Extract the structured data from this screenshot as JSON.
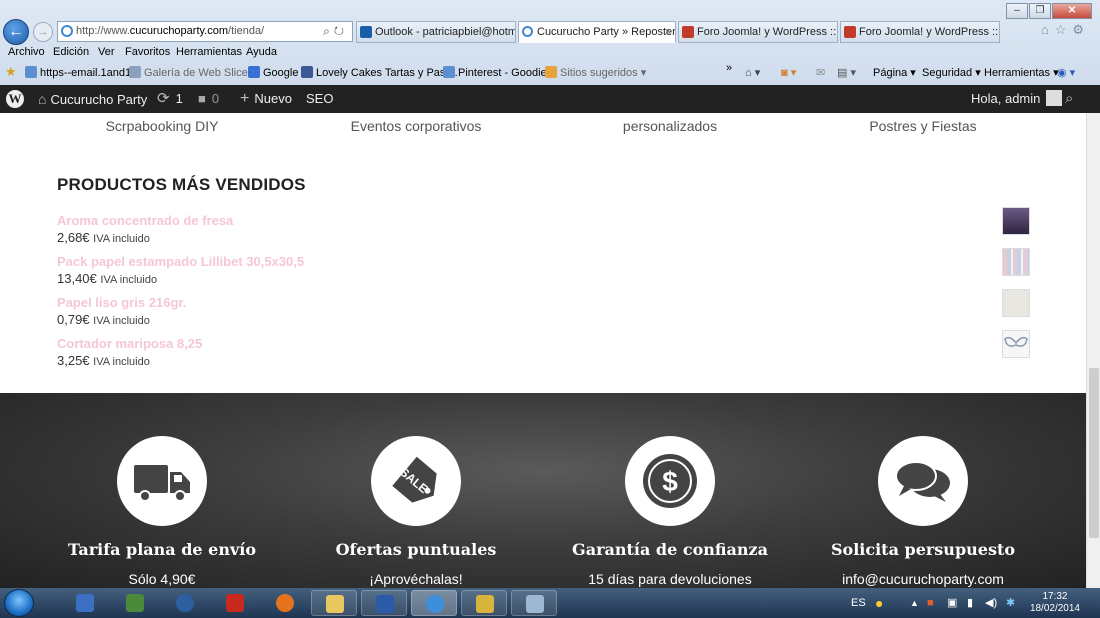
{
  "browser": {
    "address": {
      "prefix": "http://www.",
      "domain": "cucuruchoparty.com",
      "path": "/tienda/"
    },
    "tabs": [
      {
        "label": "Outlook - patriciapbiel@hotm...",
        "icon": "outlook-icon",
        "color": "#1a5ea8"
      },
      {
        "label": "Cucurucho Party » Reposter...",
        "icon": "ie-page-icon",
        "color": "#3f8ad0",
        "close": "×"
      },
      {
        "label": "Foro Joomla! y WordPress :: Te...",
        "icon": "forum-icon",
        "color": "#c23a2a"
      },
      {
        "label": "Foro Joomla! y WordPress :: Te...",
        "icon": "forum-icon",
        "color": "#c23a2a"
      }
    ],
    "menu": [
      "Archivo",
      "Edición",
      "Ver",
      "Favoritos",
      "Herramientas",
      "Ayuda"
    ],
    "favorites": [
      {
        "label": "https--email.1and1",
        "icon": "page-icon",
        "color": "#5b8fd0"
      },
      {
        "label": "Galería de Web Slice ▾",
        "icon": "webslice-icon",
        "color": "#8aa0bd",
        "muted": true
      },
      {
        "label": "Google",
        "icon": "google-icon",
        "color": "#3b6fd8"
      },
      {
        "label": "Lovely Cakes Tartas y Past...",
        "icon": "facebook-icon",
        "color": "#3b5998"
      },
      {
        "label": "Pinterest - Goodies",
        "icon": "page-icon",
        "color": "#5b8fd0"
      },
      {
        "label": "Sitios sugeridos ▾",
        "icon": "rss-icon",
        "color": "#e8a23a",
        "muted": true
      }
    ],
    "commands": [
      "Página ▾",
      "Seguridad ▾",
      "Herramientas ▾"
    ]
  },
  "wp_admin_bar": {
    "site_name": "Cucurucho Party",
    "updates_count": "1",
    "comments_count": "0",
    "new_label": "Nuevo",
    "seo_label": "SEO",
    "greeting": "Hola, admin"
  },
  "categories": [
    "Scrpabooking DIY",
    "Eventos corporativos",
    "personalizados",
    "Postres y Fiestas"
  ],
  "section_title": "PRODUCTOS MÁS VENDIDOS",
  "products": [
    {
      "name": "Aroma concentrado de fresa",
      "price": "2,68€",
      "tax": "IVA incluido",
      "thumb_color": "#4a3b5e"
    },
    {
      "name": "Pack papel estampado Lillibet 30,5x30,5",
      "price": "13,40€",
      "tax": "IVA incluido",
      "thumb_color": "#c9d3e0"
    },
    {
      "name": "Papel liso gris 216gr.",
      "price": "0,79€",
      "tax": "IVA incluido",
      "thumb_color": "#e8e7e2"
    },
    {
      "name": "Cortador mariposa 8,25",
      "price": "3,25€",
      "tax": "IVA incluido",
      "thumb_color": "#d7dde3"
    }
  ],
  "features": [
    {
      "title": "Tarifa plana de envío",
      "subtitle": "Sólo 4,90€",
      "icon": "truck-icon"
    },
    {
      "title": "Ofertas puntuales",
      "subtitle": "¡Aprovéchalas!",
      "icon": "sale-tag-icon"
    },
    {
      "title": "Garantía de confianza",
      "subtitle": "15 días para devoluciones",
      "icon": "dollar-icon"
    },
    {
      "title": "Solicita persupuesto",
      "subtitle": "info@cucuruchoparty.com",
      "icon": "chat-bubbles-icon"
    }
  ],
  "taskbar": {
    "language": "ES",
    "time": "17:32",
    "date": "18/02/2014"
  },
  "colors": {
    "product_link": "#f5c6d8",
    "admin_bar": "#222222",
    "footer_band": "#3c3c3c"
  }
}
